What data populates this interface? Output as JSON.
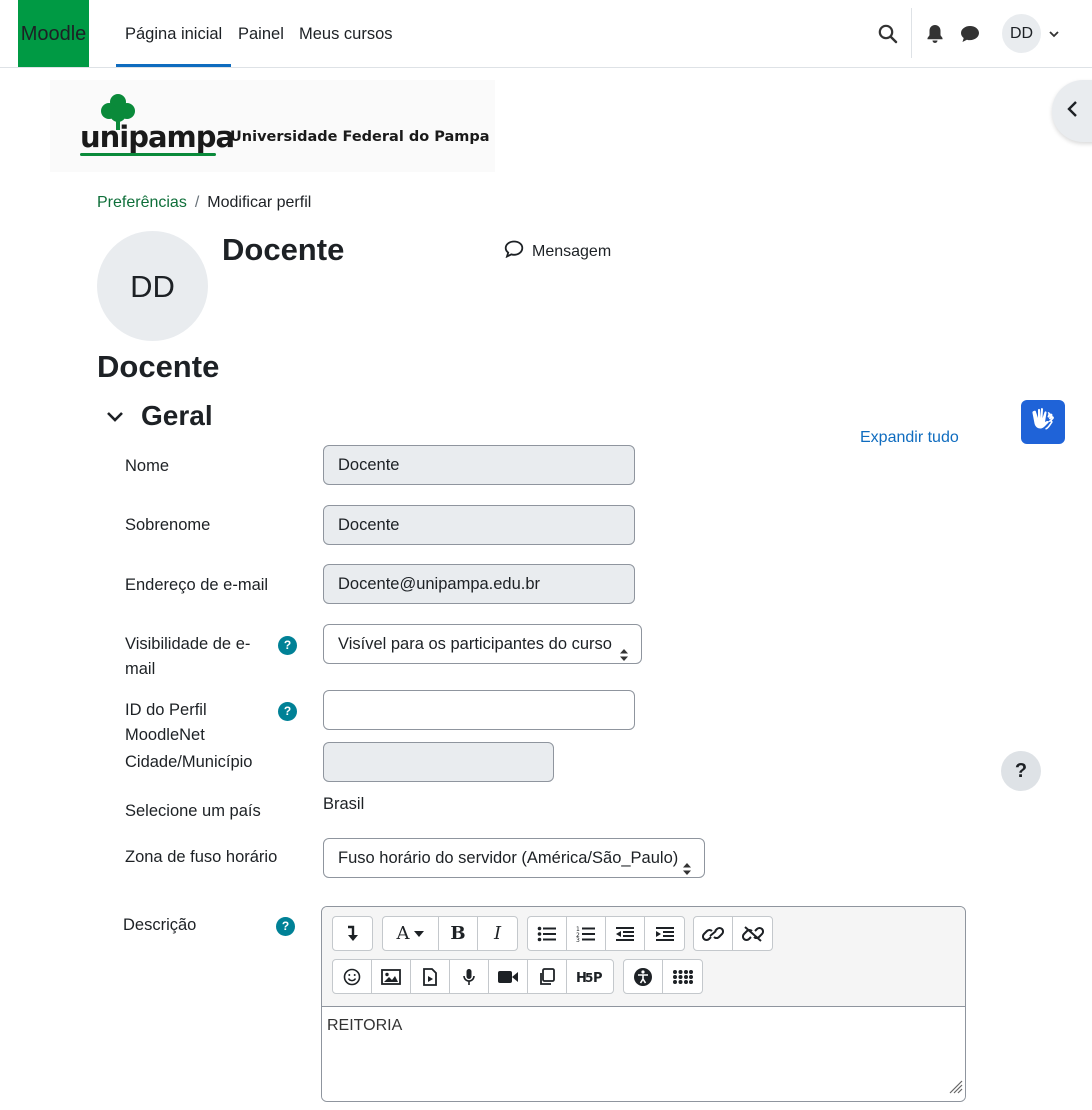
{
  "navbar": {
    "brand": "Moodle",
    "links": [
      "Página inicial",
      "Painel",
      "Meus cursos"
    ],
    "user_initials": "DD"
  },
  "logo": {
    "word": "unipampa",
    "subtitle": "Universidade Federal do Pampa"
  },
  "breadcrumb": {
    "parent": "Preferências",
    "current": "Modificar perfil"
  },
  "profile": {
    "initials": "DD",
    "name": "Docente",
    "message_label": "Mensagem"
  },
  "page_heading": "Docente",
  "section": {
    "title": "Geral",
    "expand_all": "Expandir tudo"
  },
  "form": {
    "nome_label": "Nome",
    "nome_value": "Docente",
    "sobrenome_label": "Sobrenome",
    "sobrenome_value": "Docente",
    "email_label": "Endereço de e-mail",
    "email_value": "Docente@unipampa.edu.br",
    "visibility_label_1": "Visibilidade de e-",
    "visibility_label_2": "mail",
    "visibility_value": "Visível para os participantes do curso",
    "moodlenet_label_1": "ID do Perfil",
    "moodlenet_label_2": "MoodleNet",
    "moodlenet_value": "",
    "city_label": "Cidade/Município",
    "city_value": "",
    "country_label": "Selecione um país",
    "country_value": "Brasil",
    "timezone_label": "Zona de fuso horário",
    "timezone_value": "Fuso horário do servidor (América/São_Paulo)",
    "description_label": "Descrição",
    "description_value": "REITORIA"
  },
  "help_float": "?",
  "colors": {
    "brand": "#009a44",
    "link": "#0f6cbf",
    "help": "#008196",
    "vlibras": "#1f63d8"
  }
}
